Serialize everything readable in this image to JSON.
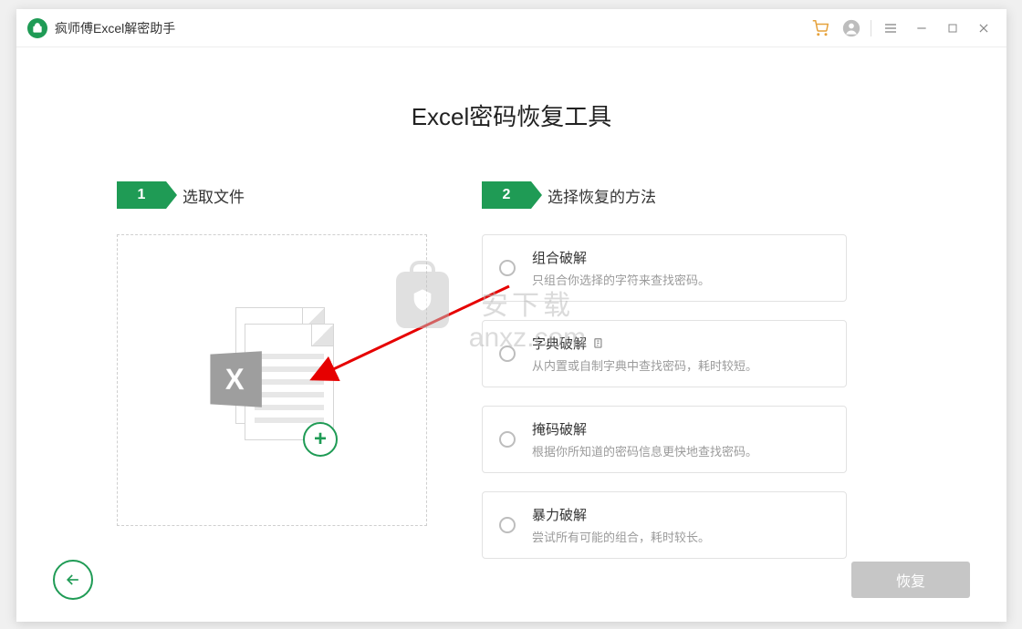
{
  "app": {
    "title": "疯师傅Excel解密助手"
  },
  "titlebar": {
    "cart": "cart",
    "account": "account",
    "menu": "menu",
    "minimize": "minimize",
    "maximize": "maximize",
    "close": "close"
  },
  "page_title": "Excel密码恢复工具",
  "step1": {
    "number": "1",
    "label": "选取文件"
  },
  "step2": {
    "number": "2",
    "label": "选择恢复的方法"
  },
  "methods": [
    {
      "title": "组合破解",
      "desc": "只组合你选择的字符来查找密码。",
      "has_page_icon": false
    },
    {
      "title": "字典破解",
      "desc": "从内置或自制字典中查找密码，耗时较短。",
      "has_page_icon": true
    },
    {
      "title": "掩码破解",
      "desc": "根据你所知道的密码信息更快地查找密码。",
      "has_page_icon": false
    },
    {
      "title": "暴力破解",
      "desc": "尝试所有可能的组合，耗时较长。",
      "has_page_icon": false
    }
  ],
  "buttons": {
    "restore": "恢复"
  },
  "excel_glyph": "X",
  "watermark": {
    "line1": "安下载",
    "line2": "anxz.com"
  },
  "colors": {
    "accent": "#1f9b55",
    "disabled": "#c6c6c6"
  }
}
